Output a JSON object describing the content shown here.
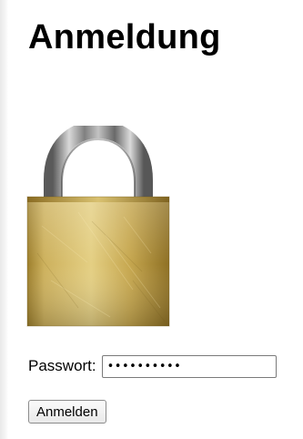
{
  "page": {
    "title": "Anmeldung"
  },
  "form": {
    "password_label": "Passwort:",
    "password_value": "••••••••••",
    "submit_label": "Anmelden"
  },
  "image": {
    "icon": "padlock-icon"
  },
  "colors": {
    "lock_body": "#c9a949",
    "shackle": "#b5b5b5",
    "background": "#ffffff"
  }
}
